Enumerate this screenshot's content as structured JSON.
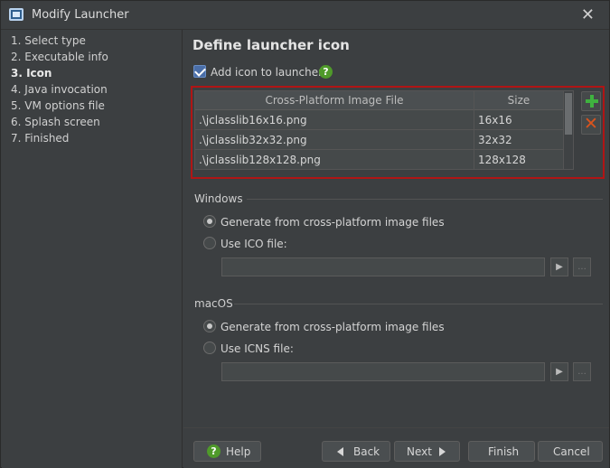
{
  "window": {
    "title": "Modify Launcher"
  },
  "steps": [
    "1. Select type",
    "2. Executable info",
    "3. Icon",
    "4. Java invocation",
    "5. VM options file",
    "6. Splash screen",
    "7. Finished"
  ],
  "active_step": "3. Icon",
  "page": {
    "title": "Define launcher icon",
    "add_icon_label": "Add icon to launcher",
    "add_icon_checked": true,
    "help_glyph": "?"
  },
  "table": {
    "columns": [
      "Cross-Platform Image File",
      "Size"
    ],
    "rows": [
      {
        "file": ".\\jclasslib16x16.png",
        "size": "16x16"
      },
      {
        "file": ".\\jclasslib32x32.png",
        "size": "32x32"
      },
      {
        "file": ".\\jclasslib128x128.png",
        "size": "128x128"
      }
    ]
  },
  "windows": {
    "label": "Windows",
    "option_generate": "Generate from cross-platform image files",
    "option_file": "Use ICO file:",
    "selected": "generate",
    "file_value": ""
  },
  "macos": {
    "label": "macOS",
    "option_generate": "Generate from cross-platform image files",
    "option_file": "Use ICNS file:",
    "selected": "generate",
    "file_value": ""
  },
  "buttons": {
    "help": "Help",
    "back": "Back",
    "next": "Next",
    "finish": "Finish",
    "cancel": "Cancel",
    "browse_glyph": "..."
  },
  "colors": {
    "accent_checkbox": "#4a6ea8",
    "highlight_border": "#b01515",
    "help_green": "#4f9a2a",
    "add_green": "#3fb23f",
    "remove_orange": "#d9541e"
  }
}
